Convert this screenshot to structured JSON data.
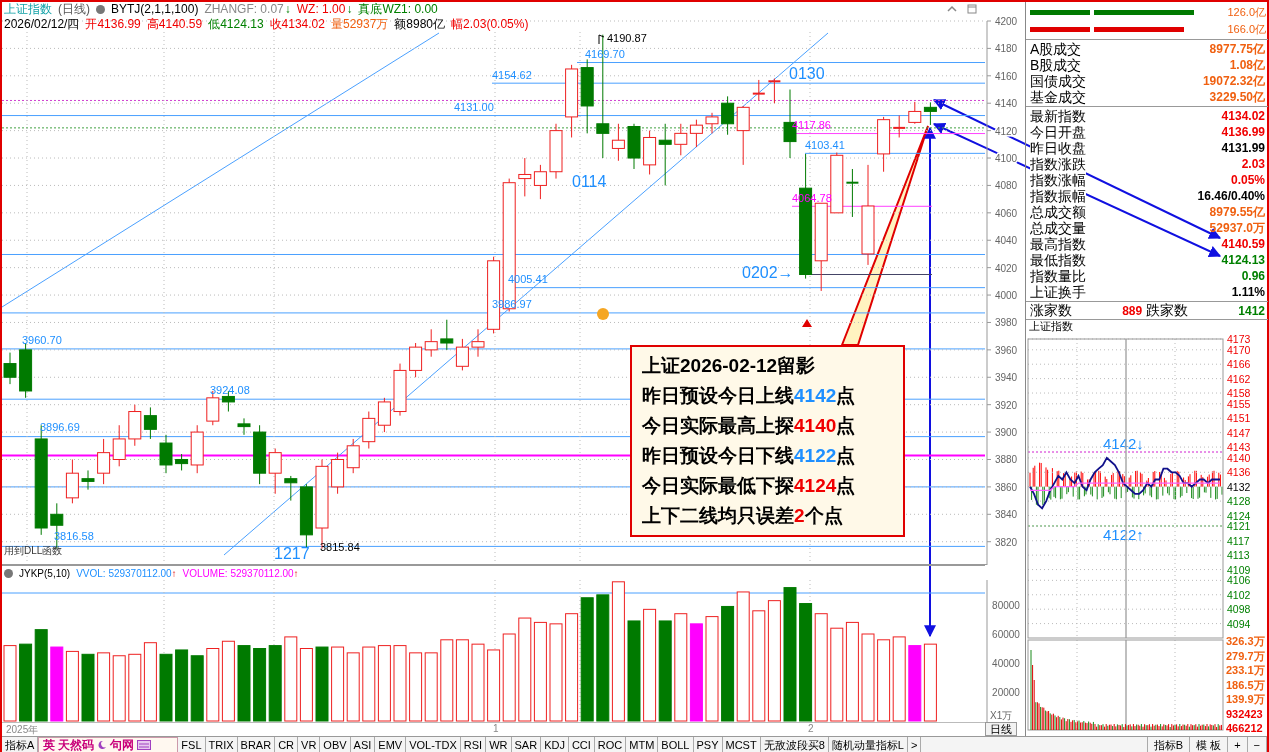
{
  "header": {
    "title": "上证指数",
    "period": "(日线)",
    "indicator": "BYTJ(2,1,1,100)",
    "readouts": [
      {
        "text": "ZHANGF: 0.07",
        "arrow": "↓",
        "color": "#888888"
      },
      {
        "text": "WZ: 1.00",
        "arrow": "↓",
        "color": "#f00000"
      },
      {
        "text": "真底WZ1: 0.00",
        "color": "#008000"
      }
    ]
  },
  "quote": [
    {
      "text": "2026/02/12/四",
      "color": "#000000"
    },
    {
      "text": "开4136.99",
      "color": "#f00000"
    },
    {
      "text": "高4140.59",
      "color": "#f00000"
    },
    {
      "text": "低4124.13",
      "color": "#008000"
    },
    {
      "text": "收4134.02",
      "color": "#f00000"
    },
    {
      "text": "量52937万",
      "color": "#f06010"
    },
    {
      "text": "额8980亿",
      "color": "#000000"
    },
    {
      "text": "幅2.03(0.05%)",
      "color": "#f00000"
    }
  ],
  "price_chart": {
    "chart_data": {
      "type": "candlestick",
      "grid": true,
      "ylim": [
        3803,
        4200
      ],
      "yticks": [
        4200,
        4180,
        4160,
        4140,
        4120,
        4100,
        4080,
        4060,
        4040,
        4020,
        4000,
        3980,
        3960,
        3940,
        3920,
        3900,
        3880,
        3860,
        3840,
        3820
      ],
      "ohlc": [
        [
          3950,
          3958,
          3935,
          3940
        ],
        [
          3960,
          3965,
          3925,
          3930
        ],
        [
          3895,
          3905,
          3825,
          3830
        ],
        [
          3840,
          3848,
          3815,
          3832
        ],
        [
          3852,
          3880,
          3848,
          3870
        ],
        [
          3866,
          3872,
          3858,
          3864
        ],
        [
          3870,
          3895,
          3862,
          3885
        ],
        [
          3880,
          3905,
          3875,
          3895
        ],
        [
          3895,
          3920,
          3890,
          3915
        ],
        [
          3912,
          3918,
          3895,
          3902
        ],
        [
          3892,
          3898,
          3870,
          3876
        ],
        [
          3880,
          3884,
          3872,
          3877
        ],
        [
          3876,
          3905,
          3870,
          3900
        ],
        [
          3908,
          3930,
          3905,
          3925
        ],
        [
          3926,
          3930,
          3915,
          3922
        ],
        [
          3906,
          3910,
          3898,
          3904
        ],
        [
          3900,
          3905,
          3862,
          3870
        ],
        [
          3870,
          3888,
          3855,
          3885
        ],
        [
          3866,
          3868,
          3850,
          3863
        ],
        [
          3860,
          3862,
          3816,
          3825
        ],
        [
          3830,
          3880,
          3815,
          3875
        ],
        [
          3860,
          3885,
          3855,
          3880
        ],
        [
          3874,
          3895,
          3870,
          3890
        ],
        [
          3893,
          3915,
          3888,
          3910
        ],
        [
          3905,
          3925,
          3900,
          3922
        ],
        [
          3915,
          3950,
          3912,
          3945
        ],
        [
          3945,
          3965,
          3940,
          3962
        ],
        [
          3960,
          3975,
          3955,
          3966
        ],
        [
          3968,
          3982,
          3960,
          3965
        ],
        [
          3948,
          3968,
          3945,
          3962
        ],
        [
          3962,
          3975,
          3955,
          3966
        ],
        [
          3975,
          4028,
          3972,
          4025
        ],
        [
          3990,
          4085,
          3988,
          4082
        ],
        [
          4085,
          4100,
          4072,
          4088
        ],
        [
          4080,
          4095,
          4070,
          4090
        ],
        [
          4090,
          4125,
          4085,
          4120
        ],
        [
          4130,
          4168,
          4115,
          4165
        ],
        [
          4166,
          4172,
          4118,
          4138
        ],
        [
          4125,
          4190,
          4100,
          4118
        ],
        [
          4107,
          4125,
          4098,
          4113
        ],
        [
          4123,
          4125,
          4092,
          4100
        ],
        [
          4095,
          4120,
          4088,
          4115
        ],
        [
          4113,
          4125,
          4080,
          4110
        ],
        [
          4110,
          4125,
          4102,
          4118
        ],
        [
          4118,
          4128,
          4108,
          4124
        ],
        [
          4125,
          4133,
          4118,
          4130
        ],
        [
          4140,
          4145,
          4117,
          4125
        ],
        [
          4120,
          4138,
          4095,
          4137
        ],
        [
          4147,
          4157,
          4142,
          4147
        ],
        [
          4155,
          4158,
          4140,
          4156
        ],
        [
          4126,
          4150,
          4100,
          4112
        ],
        [
          4078,
          4103,
          4012,
          4015
        ],
        [
          4025,
          4067,
          4003,
          4067
        ],
        [
          4060,
          4104,
          4060,
          4102
        ],
        [
          4082,
          4092,
          4057,
          4081
        ],
        [
          4030,
          4095,
          4022,
          4065
        ],
        [
          4103,
          4130,
          4090,
          4128
        ],
        [
          4122,
          4131,
          4115,
          4122
        ],
        [
          4126,
          4141,
          4125,
          4134
        ],
        [
          4136.99,
          4140.59,
          4124.13,
          4134.02
        ]
      ]
    },
    "labels": [
      {
        "text": "4190.87",
        "color": "#000000"
      },
      {
        "text": "4169.70",
        "color": "#1e8fff"
      },
      {
        "text": "4154.62",
        "color": "#1e8fff"
      },
      {
        "text": "4131.00",
        "color": "#1e8fff"
      },
      {
        "text": "0130",
        "color": "#1e8fff",
        "kind": "big"
      },
      {
        "text": "4117.86",
        "color": "#ff00ff"
      },
      {
        "text": "4103.41",
        "color": "#1e8fff"
      },
      {
        "text": "0114",
        "color": "#1e8fff",
        "kind": "big"
      },
      {
        "text": "4064.78",
        "color": "#ff00ff"
      },
      {
        "text": "0202→",
        "color": "#1e8fff",
        "kind": "big"
      },
      {
        "text": "4005.41",
        "color": "#1e8fff"
      },
      {
        "text": "3986.97",
        "color": "#1e8fff"
      },
      {
        "text": "3960.70",
        "color": "#1e8fff"
      },
      {
        "text": "3924.08",
        "color": "#1e8fff"
      },
      {
        "text": "3896.69",
        "color": "#1e8fff"
      },
      {
        "text": "3816.58",
        "color": "#1e8fff"
      },
      {
        "text": "3815.84",
        "color": "#000000"
      },
      {
        "text": "1217",
        "color": "#1e8fff",
        "kind": "big"
      }
    ],
    "note": "用到DLL函数"
  },
  "callout": {
    "lines": [
      {
        "parts": [
          {
            "text": "上证2026-02-12留影"
          }
        ]
      },
      {
        "parts": [
          {
            "text": "昨日预设今日上线"
          },
          {
            "text": "4142",
            "kind": "forecast"
          },
          {
            "text": "点"
          }
        ]
      },
      {
        "parts": [
          {
            "text": "今日实际最高上探"
          },
          {
            "text": "4140",
            "kind": "actual"
          },
          {
            "text": "点"
          }
        ]
      },
      {
        "parts": [
          {
            "text": "昨日预设今日下线"
          },
          {
            "text": "4122",
            "kind": "forecast"
          },
          {
            "text": "点"
          }
        ]
      },
      {
        "parts": [
          {
            "text": "今日实际最低下探"
          },
          {
            "text": "4124",
            "kind": "actual"
          },
          {
            "text": "点"
          }
        ]
      },
      {
        "parts": [
          {
            "text": "上下二线均只误差"
          },
          {
            "text": "2",
            "kind": "actual"
          },
          {
            "text": "个点"
          }
        ]
      }
    ]
  },
  "volume_pane": {
    "indicator": "JYKP(5,10)",
    "series": [
      {
        "text": "VVOL: 529370112.00",
        "arrow": "↑",
        "color": "#1e8fff"
      },
      {
        "text": "VOLUME: 529370112.00",
        "arrow": "↑",
        "color": "#ff00ff"
      }
    ],
    "axis": [
      "80000",
      "60000",
      "40000",
      "20000"
    ],
    "unit": "X1万"
  },
  "dates": [
    "2025年",
    "1",
    "2"
  ],
  "period_button": "日线",
  "ime": {
    "mode": "英",
    "name": "天然码",
    "punct": "句网"
  },
  "tabs": [
    "指标A",
    "FSL",
    "TRIX",
    "BRAR",
    "CR",
    "VR",
    "OBV",
    "ASI",
    "EMV",
    "VOL-TDX",
    "RSI",
    "WR",
    "SAR",
    "KDJ",
    "CCI",
    "ROC",
    "MTM",
    "BOLL",
    "PSY",
    "MCST",
    "无敌波段买8",
    "随机动量指标L",
    ">"
  ],
  "right_tabs": [
    "指标B",
    "模 板",
    "+",
    "−"
  ],
  "side": {
    "bars": [
      {
        "label": "126.0亿",
        "kind": "up"
      },
      {
        "label": "166.0亿",
        "kind": "down"
      }
    ],
    "turnover": [
      {
        "label": "A股成交",
        "value": "8977.75亿",
        "color": "#f06010"
      },
      {
        "label": "B股成交",
        "value": "1.08亿",
        "color": "#f06010"
      },
      {
        "label": "国债成交",
        "value": "19072.32亿",
        "color": "#f06010"
      },
      {
        "label": "基金成交",
        "value": "3229.50亿",
        "color": "#f06010"
      }
    ],
    "stats": [
      {
        "label": "最新指数",
        "value": "4134.02",
        "color": "#f00000"
      },
      {
        "label": "今日开盘",
        "value": "4136.99",
        "color": "#f00000"
      },
      {
        "label": "昨日收盘",
        "value": "4131.99",
        "color": "#000000"
      },
      {
        "label": "指数涨跌",
        "value": "2.03",
        "color": "#f00000"
      },
      {
        "label": "指数涨幅",
        "value": "0.05%",
        "color": "#f00000"
      },
      {
        "label": "指数振幅",
        "value": "16.46/0.40%",
        "color": "#000000"
      },
      {
        "label": "总成交额",
        "value": "8979.55亿",
        "color": "#f06010"
      },
      {
        "label": "总成交量",
        "value": "52937.0万",
        "color": "#f06010"
      },
      {
        "label": "最高指数",
        "value": "4140.59",
        "color": "#f00000"
      },
      {
        "label": "最低指数",
        "value": "4124.13",
        "color": "#008000"
      },
      {
        "label": "指数量比",
        "value": "0.96",
        "color": "#008000"
      },
      {
        "label": "上证换手",
        "value": "1.11%",
        "color": "#000000"
      }
    ],
    "breadth": {
      "up_label": "涨家数",
      "up_count": "889",
      "down_label": "跌家数",
      "down_count": "1412"
    },
    "intraday": {
      "title": "上证指数",
      "volume_axis": [
        {
          "text": "326.3万",
          "color": "#f06010"
        },
        {
          "text": "279.7万",
          "color": "#f06010"
        },
        {
          "text": "233.1万",
          "color": "#f06010"
        },
        {
          "text": "186.5万",
          "color": "#f06010"
        },
        {
          "text": "139.9万",
          "color": "#f06010"
        },
        {
          "text": "932423",
          "color": "#f00000"
        },
        {
          "text": "466212",
          "color": "#f00000"
        }
      ],
      "marks": [
        "4142↓",
        "4122↑"
      ],
      "chart_data": {
        "type": "line",
        "grid": true,
        "ylim": [
          4090,
          4173
        ],
        "yticks": [
          4173,
          4170,
          4166,
          4162,
          4158,
          4155,
          4151,
          4147,
          4143,
          4140,
          4136,
          4132,
          4128,
          4124,
          4121,
          4117,
          4113,
          4109,
          4106,
          4102,
          4098,
          4094
        ],
        "series": [
          {
            "color": "#10108a",
            "values": [
              4132,
              4130,
              4127,
              4126,
              4128,
              4131,
              4133,
              4135,
              4134,
              4136,
              4134,
              4133,
              4135,
              4132,
              4131,
              4134,
              4136,
              4137,
              4138,
              4140,
              4139,
              4138,
              4136,
              4133,
              4132,
              4131,
              4130,
              4130,
              4131,
              4133,
              4132,
              4134,
              4134,
              4137,
              4137,
              4136,
              4136,
              4135,
              4133,
              4133,
              4132,
              4133,
              4134,
              4134,
              4133,
              4134,
              4134,
              4134
            ]
          },
          {
            "color": "#ff60ff",
            "values": [
              4131,
              4131,
              4131,
              4131,
              4131,
              4131,
              4132,
              4132,
              4132,
              4132,
              4132,
              4132,
              4133,
              4133,
              4133,
              4133,
              4133,
              4133,
              4133,
              4133,
              4133,
              4133,
              4133,
              4133,
              4133,
              4133,
              4133,
              4133,
              4133,
              4133,
              4133,
              4133,
              4133,
              4133,
              4133,
              4133,
              4133,
              4133,
              4133,
              4133,
              4133,
              4133,
              4133,
              4133,
              4133,
              4133,
              4133,
              4133
            ]
          }
        ]
      }
    }
  }
}
